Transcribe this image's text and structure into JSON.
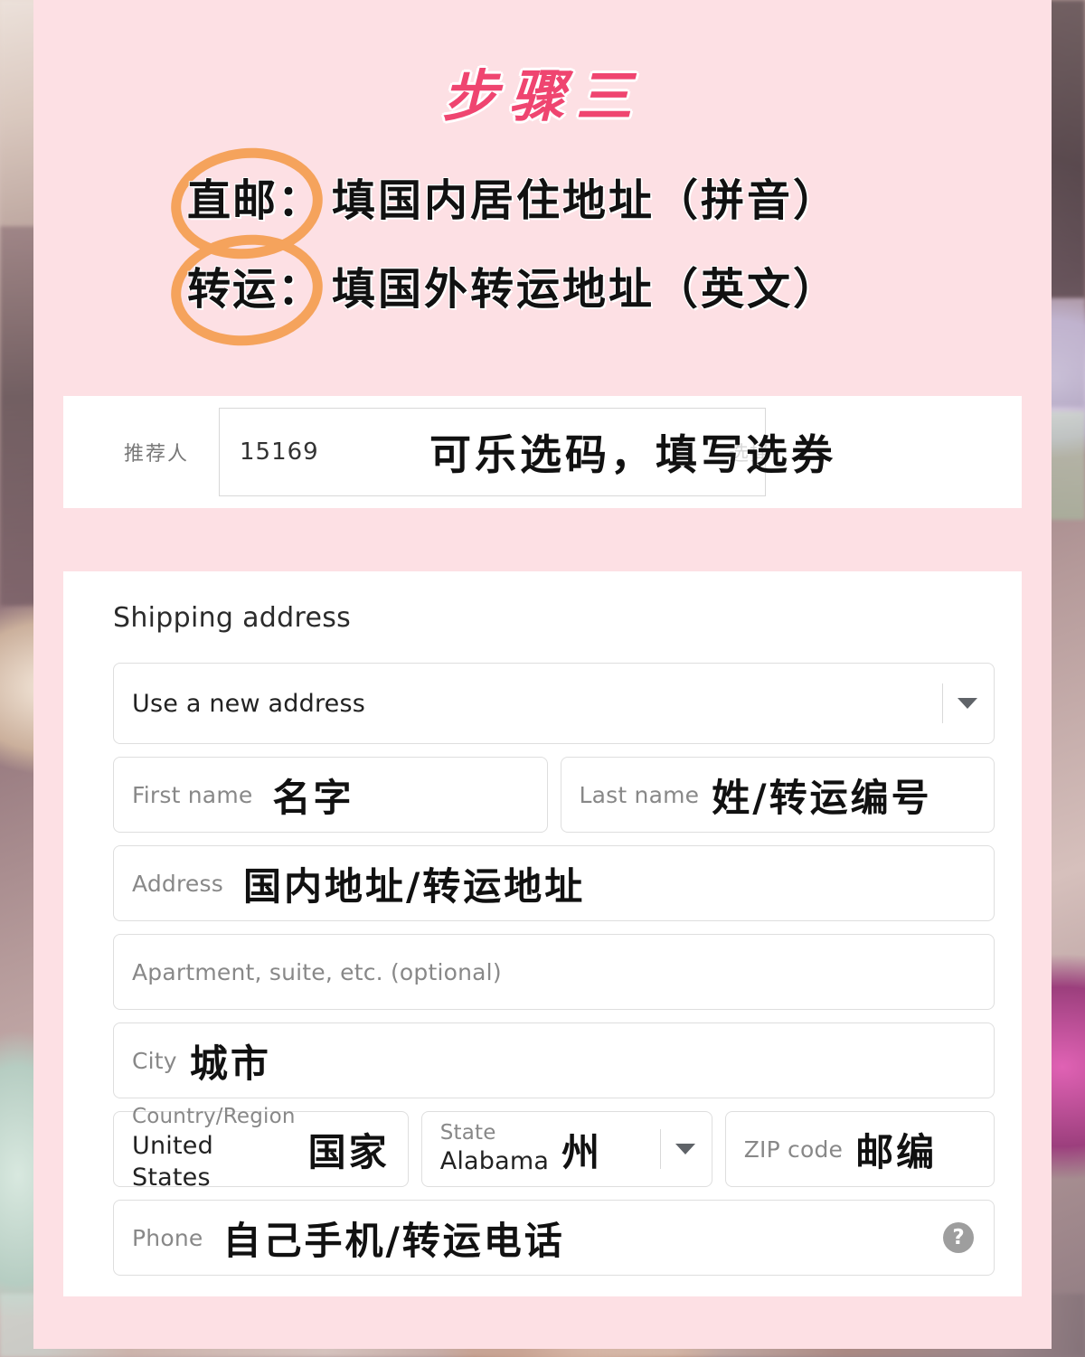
{
  "colors": {
    "pink_card": "#fde0e4",
    "title_pink": "#ef4570",
    "ring_orange": "#f5a35c",
    "ink_black": "#111111",
    "label_gray": "#888888"
  },
  "title": "步骤三",
  "note": {
    "lines": [
      {
        "key": "直邮：",
        "value": "填国内居住地址（拼音）"
      },
      {
        "key": "转运：",
        "value": "填国外转运地址（英文）"
      }
    ]
  },
  "referrer": {
    "label": "推荐人",
    "value": "15169",
    "ghost_text": "选择",
    "annotation": "可乐选码，填写选券"
  },
  "shipping": {
    "heading": "Shipping address",
    "address_select": {
      "selected": "Use a new address",
      "caret_icon": "chevron-down-icon"
    },
    "fields": {
      "first_name": {
        "label": "First name",
        "annotation": "名字"
      },
      "last_name": {
        "label": "Last name",
        "annotation": "姓/转运编号"
      },
      "address": {
        "label": "Address",
        "annotation": "国内地址/转运地址"
      },
      "apartment": {
        "placeholder": "Apartment, suite, etc. (optional)"
      },
      "city": {
        "label": "City",
        "annotation": "城市"
      },
      "country": {
        "label": "Country/Region",
        "value": "United States",
        "annotation": "国家"
      },
      "state": {
        "label": "State",
        "value": "Alabama",
        "annotation": "州",
        "caret_icon": "chevron-down-icon"
      },
      "zip": {
        "label": "ZIP code",
        "annotation": "邮编"
      },
      "phone": {
        "label": "Phone",
        "annotation": "自己手机/转运电话",
        "help_icon": "help-circle-icon",
        "help_glyph": "?"
      }
    }
  }
}
